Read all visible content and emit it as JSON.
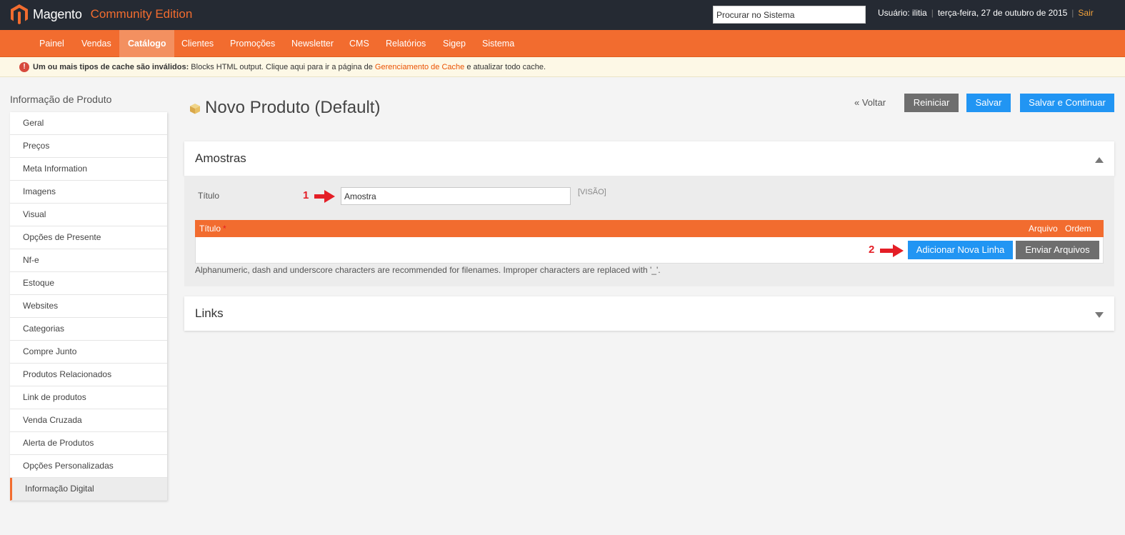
{
  "app": {
    "logo_text": "Magento",
    "edition": "Community Edition"
  },
  "header": {
    "search_placeholder": "Procurar no Sistema",
    "user": "Usuário: ilitia",
    "date": "terça-feira, 27 de outubro de 2015",
    "logout": "Sair"
  },
  "nav": {
    "items": [
      {
        "label": "Painel"
      },
      {
        "label": "Vendas"
      },
      {
        "label": "Catálogo",
        "active": true
      },
      {
        "label": "Clientes"
      },
      {
        "label": "Promoções"
      },
      {
        "label": "Newsletter"
      },
      {
        "label": "CMS"
      },
      {
        "label": "Relatórios"
      },
      {
        "label": "Sigep"
      },
      {
        "label": "Sistema"
      }
    ]
  },
  "message": {
    "bold": "Um ou mais tipos de cache são inválidos:",
    "text": " Blocks HTML output. Clique aqui para ir a página de ",
    "link": "Gerenciamento de Cache",
    "after": " e atualizar todo cache."
  },
  "sidebar": {
    "title": "Informação de Produto",
    "items": [
      {
        "label": "Geral"
      },
      {
        "label": "Preços"
      },
      {
        "label": "Meta Information"
      },
      {
        "label": "Imagens"
      },
      {
        "label": "Visual"
      },
      {
        "label": "Opções de Presente"
      },
      {
        "label": "Nf-e"
      },
      {
        "label": "Estoque"
      },
      {
        "label": "Websites"
      },
      {
        "label": "Categorias"
      },
      {
        "label": "Compre Junto"
      },
      {
        "label": "Produtos Relacionados"
      },
      {
        "label": "Link de produtos"
      },
      {
        "label": "Venda Cruzada"
      },
      {
        "label": "Alerta de Produtos"
      },
      {
        "label": "Opções Personalizadas"
      },
      {
        "label": "Informação Digital",
        "active": true
      }
    ]
  },
  "page": {
    "title": "Novo Produto (Default)",
    "back": "« Voltar",
    "reset": "Reiniciar",
    "save": "Salvar",
    "save_continue": "Salvar e Continuar"
  },
  "samples": {
    "title": "Amostras",
    "field_label": "Título",
    "field_value": "Amostra",
    "scope": "[VISÃO]",
    "marker_1": "1",
    "marker_2": "2",
    "grid": {
      "col_title": "Título",
      "required_mark": "*",
      "col_file": "Arquivo",
      "col_order": "Ordem"
    },
    "add_row": "Adicionar Nova Linha",
    "upload": "Enviar Arquivos",
    "hint": "Alphanumeric, dash and underscore characters are recommended for filenames. Improper characters are replaced with '_'."
  },
  "links": {
    "title": "Links"
  },
  "colors": {
    "accent": "#f26c2f",
    "header_bg": "#252a33",
    "button_blue": "#2195f3",
    "button_gray": "#6e6e6e",
    "marker_red": "#e41e26"
  }
}
